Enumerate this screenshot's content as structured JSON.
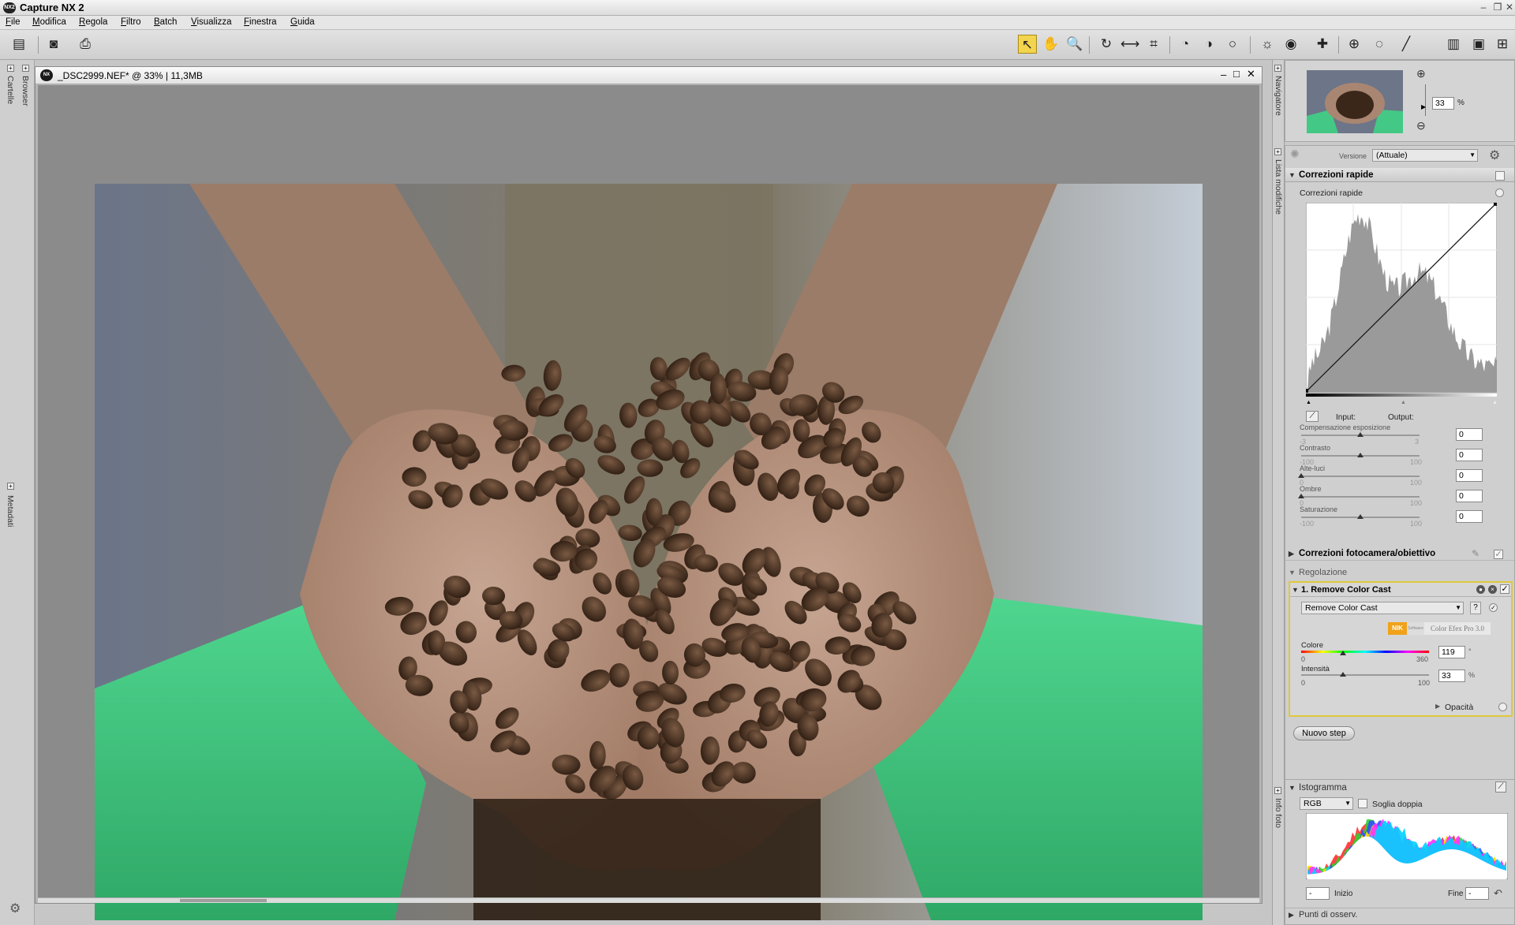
{
  "app": {
    "title": "Capture NX 2",
    "logo_text": "NX2"
  },
  "menu": [
    "File",
    "Modifica",
    "Regola",
    "Filtro",
    "Batch",
    "Visualizza",
    "Finestra",
    "Guida"
  ],
  "left_panel": {
    "tab_folders": "Cartelle",
    "tab_browser": "Browser",
    "tab_metadata": "Metadati"
  },
  "document": {
    "title": "_DSC2999.NEF* @ 33% | 11,3MB",
    "image_description_icon": "coffee-beans-in-hands-photo"
  },
  "navigator": {
    "tab": "Navigatore",
    "zoom_value": "33",
    "zoom_unit": "%"
  },
  "edit_list": {
    "tab": "Lista modifiche",
    "version_label": "Versione",
    "version_value": "(Attuale)",
    "quick_fix": {
      "header": "Correzioni rapide",
      "sub_label": "Correzioni rapide",
      "input_label": "Input:",
      "output_label": "Output:",
      "sliders": [
        {
          "label": "Compensazione esposizione",
          "min": "-3",
          "max": "3",
          "value": "0",
          "level": 0.5
        },
        {
          "label": "Contrasto",
          "min": "-100",
          "max": "100",
          "value": "0",
          "level": 0.5
        },
        {
          "label": "Alte-luci",
          "min": "0",
          "max": "100",
          "value": "0",
          "level": 0.0
        },
        {
          "label": "Ombre",
          "min": "0",
          "max": "100",
          "value": "0",
          "level": 0.0
        },
        {
          "label": "Saturazione",
          "min": "-100",
          "max": "100",
          "value": "0",
          "level": 0.5
        }
      ]
    },
    "camera_lens": {
      "header": "Correzioni fotocamera/obiettivo"
    },
    "adjust": {
      "header": "Regolazione"
    },
    "step": {
      "header": "1. Remove Color Cast",
      "filter_select": "Remove Color Cast",
      "help": "?",
      "nik_logo": "NIK",
      "nik_sub": "Software",
      "cef_label": "Color Efex Pro 3.0",
      "colore_label": "Colore",
      "colore_min": "0",
      "colore_max": "360",
      "colore_value": "119",
      "colore_unit": "°",
      "colore_level": 0.33,
      "intensita_label": "Intensità",
      "intensita_min": "0",
      "intensita_max": "100",
      "intensita_value": "33",
      "intensita_unit": "%",
      "intensita_level": 0.33,
      "opacity_label": "Opacità"
    },
    "new_step_button": "Nuovo step"
  },
  "photo_info": {
    "tab": "Info foto",
    "histogram_header": "Istogramma",
    "channel": "RGB",
    "double_threshold_label": "Soglia doppia",
    "start_label": "Inizio",
    "end_label": "Fine",
    "start_value": "-",
    "end_value": "-",
    "watch_points": "Punti di osserv."
  },
  "colors": {
    "active_tool": "#f3d44e",
    "step_border": "#e0c83a",
    "photo_green": "#3fbf7a"
  }
}
